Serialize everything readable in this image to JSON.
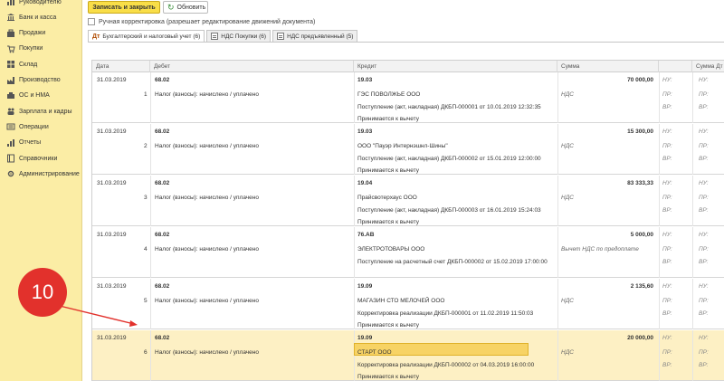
{
  "sidebar": {
    "items": [
      {
        "label": "Руководителю",
        "icon": "chart-icon"
      },
      {
        "label": "Банк и касса",
        "icon": "bank-icon"
      },
      {
        "label": "Продажи",
        "icon": "sales-icon"
      },
      {
        "label": "Покупки",
        "icon": "cart-icon"
      },
      {
        "label": "Склад",
        "icon": "warehouse-icon"
      },
      {
        "label": "Производство",
        "icon": "factory-icon"
      },
      {
        "label": "ОС и НМА",
        "icon": "assets-icon"
      },
      {
        "label": "Зарплата и кадры",
        "icon": "people-icon"
      },
      {
        "label": "Операции",
        "icon": "operations-icon"
      },
      {
        "label": "Отчеты",
        "icon": "reports-icon"
      },
      {
        "label": "Справочники",
        "icon": "book-icon"
      },
      {
        "label": "Администрирование",
        "icon": "gear-icon"
      }
    ]
  },
  "toolbar": {
    "save_close_label": "Записать и закрыть",
    "refresh_label": "Обновить"
  },
  "manual_adjust": {
    "label": "Ручная корректировка (разрешает редактирование движений документа)",
    "checked": false
  },
  "tabs": [
    {
      "label": "Бухгалтерский и налоговый учет (6)",
      "active": true
    },
    {
      "label": "НДС Покупки (6)",
      "active": false
    },
    {
      "label": "НДС предъявленный (5)",
      "active": false
    }
  ],
  "columns": {
    "date": "Дата",
    "debit": "Дебет",
    "credit": "Кредит",
    "amount": "Сумма",
    "amount_dt": "Сумма Дт"
  },
  "side_labels": {
    "nu": "НУ:",
    "pr": "ПР:",
    "vr": "ВР:"
  },
  "rows": [
    {
      "date": "31.03.2019",
      "num": "1",
      "debit_acc": "68.02",
      "debit_sub": "Налог (взносы): начислено / уплачено",
      "credit_acc": "19.03",
      "credit_line1": "ГЭС ПОВОЛЖЬЕ ООО",
      "credit_line2": "Поступление (акт, накладная) ДКБП-000001 от 10.01.2019 12:32:35",
      "credit_line3": "Принимается к вычету",
      "amount": "70 000,00",
      "amount_note": "НДС",
      "selected": false
    },
    {
      "date": "31.03.2019",
      "num": "2",
      "debit_acc": "68.02",
      "debit_sub": "Налог (взносы): начислено / уплачено",
      "credit_acc": "19.03",
      "credit_line1": "ООО \"Пауэр Интернэшнл-Шины\"",
      "credit_line2": "Поступление (акт, накладная) ДКБП-000002 от 15.01.2019 12:00:00",
      "credit_line3": "Принимается к вычету",
      "amount": "15 300,00",
      "amount_note": "НДС",
      "selected": false
    },
    {
      "date": "31.03.2019",
      "num": "3",
      "debit_acc": "68.02",
      "debit_sub": "Налог (взносы): начислено / уплачено",
      "credit_acc": "19.04",
      "credit_line1": "Прайсвотерхаус ООО",
      "credit_line2": "Поступление (акт, накладная) ДКБП-000003 от 16.01.2019 15:24:03",
      "credit_line3": "Принимается к вычету",
      "amount": "83 333,33",
      "amount_note": "НДС",
      "selected": false
    },
    {
      "date": "31.03.2019",
      "num": "4",
      "debit_acc": "68.02",
      "debit_sub": "Налог (взносы): начислено / уплачено",
      "credit_acc": "76.АВ",
      "credit_line1": "ЭЛЕКТРОТОВАРЫ ООО",
      "credit_line2": "Поступление на расчетный счет ДКБП-000002 от 15.02.2019 17:00:00",
      "credit_line3": "",
      "amount": "5 000,00",
      "amount_note": "Вычет НДС по предоплате",
      "selected": false
    },
    {
      "date": "31.03.2019",
      "num": "5",
      "debit_acc": "68.02",
      "debit_sub": "Налог (взносы): начислено / уплачено",
      "credit_acc": "19.09",
      "credit_line1": "МАГАЗИН СТО МЕЛОЧЕЙ ООО",
      "credit_line2": "Корректировка реализации ДКБП-000001 от 11.02.2019 11:50:03",
      "credit_line3": "Принимается к вычету",
      "amount": "2 135,60",
      "amount_note": "НДС",
      "selected": false
    },
    {
      "date": "31.03.2019",
      "num": "6",
      "debit_acc": "68.02",
      "debit_sub": "Налог (взносы): начислено / уплачено",
      "credit_acc": "19.09",
      "credit_line1": "СТАРТ ООО",
      "credit_line2": "Корректировка реализации ДКБП-000002 от 04.03.2019 16:00:00",
      "credit_line3": "Принимается к вычету",
      "amount": "20 000,00",
      "amount_note": "НДС",
      "selected": true
    }
  ],
  "annotation": {
    "label": "10",
    "color": "#e2312c"
  }
}
